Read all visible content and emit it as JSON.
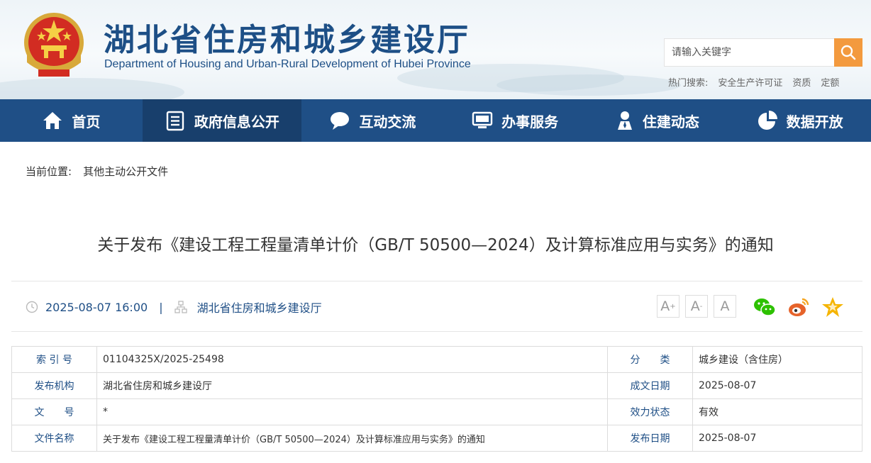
{
  "header": {
    "title": "湖北省住房和城乡建设厅",
    "subtitle": "Department of Housing and Urban-Rural Development of Hubei Province",
    "search_placeholder": "请输入关键字",
    "hot_label": "热门搜索:",
    "hot_items": [
      "安全生产许可证",
      "资质",
      "定额"
    ]
  },
  "nav": {
    "items": [
      {
        "label": "首页",
        "icon": "home-icon"
      },
      {
        "label": "政府信息公开",
        "icon": "document-list-icon"
      },
      {
        "label": "互动交流",
        "icon": "chat-bubble-icon"
      },
      {
        "label": "办事服务",
        "icon": "monitor-icon"
      },
      {
        "label": "住建动态",
        "icon": "person-icon"
      },
      {
        "label": "数据开放",
        "icon": "pie-chart-icon"
      }
    ],
    "active_index": 1
  },
  "breadcrumb": {
    "label": "当前位置:",
    "current": "其他主动公开文件"
  },
  "article": {
    "title": "关于发布《建设工程工程量清单计价（GB/T 50500—2024）及计算标准应用与实务》的通知",
    "datetime": "2025-08-07 16:00",
    "separator": "|",
    "source": "湖北省住房和城乡建设厅",
    "font_controls": [
      "A+",
      "A-",
      "A"
    ]
  },
  "info_table": {
    "rows": [
      {
        "l1": "索 引 号",
        "v1": "01104325X/2025-25498",
        "l2": "分　　类",
        "v2": "城乡建设（含住房）"
      },
      {
        "l1": "发布机构",
        "v1": "湖北省住房和城乡建设厅",
        "l2": "成文日期",
        "v2": "2025-08-07"
      },
      {
        "l1": "文　　号",
        "v1": "*",
        "l2": "效力状态",
        "v2": "有效"
      },
      {
        "l1": "文件名称",
        "v1": "关于发布《建设工程工程量清单计价（GB/T 50500—2024）及计算标准应用与实务》的通知",
        "l2": "发布日期",
        "v2": "2025-08-07"
      }
    ]
  },
  "colors": {
    "brand_blue": "#1f4f86",
    "nav_active": "#183f6c",
    "search_orange": "#f39a3e",
    "wechat_green": "#2dc100",
    "weibo_orange": "#e6632a",
    "star_yellow": "#f5b400"
  }
}
